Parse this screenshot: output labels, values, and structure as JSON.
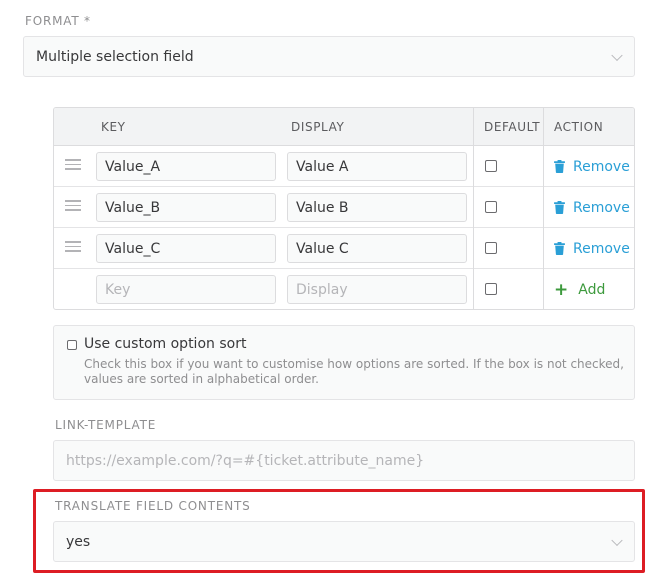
{
  "format": {
    "label": "FORMAT *",
    "value": "Multiple selection field"
  },
  "options_table": {
    "headers": {
      "key": "KEY",
      "display": "DISPLAY",
      "default": "DEFAULT",
      "action": "ACTION"
    },
    "rows": [
      {
        "key": "Value_A",
        "display": "Value A",
        "action": "Remove"
      },
      {
        "key": "Value_B",
        "display": "Value B",
        "action": "Remove"
      },
      {
        "key": "Value_C",
        "display": "Value C",
        "action": "Remove"
      }
    ],
    "new_row": {
      "key_placeholder": "Key",
      "display_placeholder": "Display",
      "action": "Add"
    }
  },
  "custom_sort": {
    "label": "Use custom option sort",
    "help": "Check this box if you want to customise how options are sorted. If the box is not checked, values are sorted in alphabetical order."
  },
  "link_template": {
    "label": "LINK-TEMPLATE",
    "placeholder": "https://example.com/?q=#{ticket.attribute_name}"
  },
  "translate": {
    "label": "TRANSLATE FIELD CONTENTS",
    "value": "yes"
  },
  "colors": {
    "remove": "#2a9fd6",
    "add": "#3d9a3d",
    "highlight": "#dd1d24"
  }
}
